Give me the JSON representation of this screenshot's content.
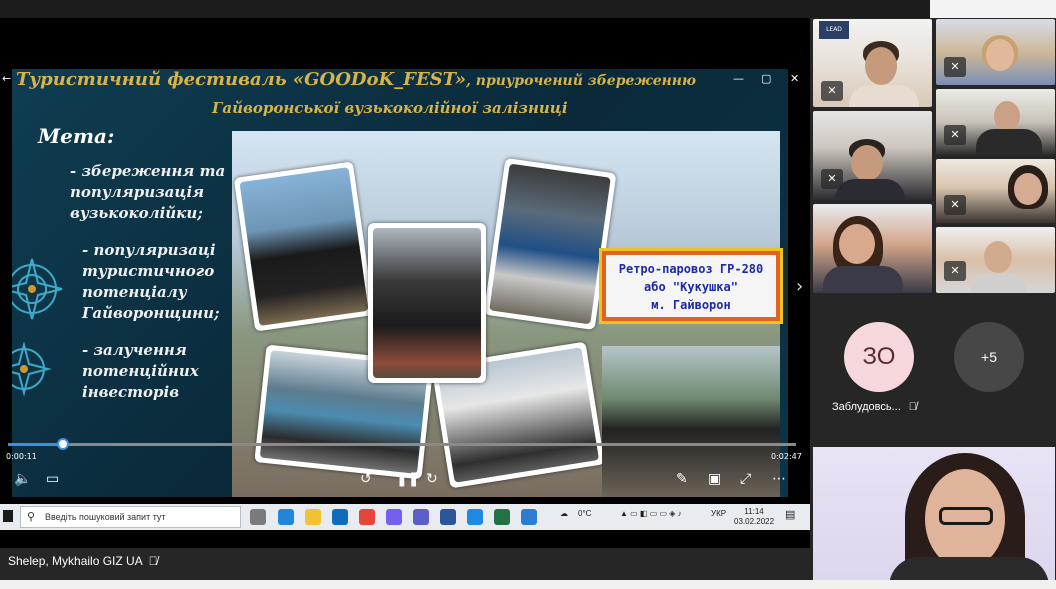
{
  "slide": {
    "title_main": "Туристичний фестиваль «GOODoK_FEST»",
    "title_suffix": ", приурочений збереженню",
    "title_line2": "Гайворонської вузькоколійної залізниці",
    "meta_heading": "Мета:",
    "bullets": [
      "- збереження та популяризація вузькоколійки;",
      "- популяризаці туристичного потенціалу Гайворонщини;",
      "- залучення потенційних інвесторів"
    ],
    "label_line1": "Ретро-паровоз ГР-280",
    "label_line2": "або \"Кукушка\"",
    "label_line3": "м. Гайворон"
  },
  "video": {
    "time_current": "0:00:11",
    "time_total": "0:02:47",
    "progress_fraction": 0.07
  },
  "taskbar": {
    "search_placeholder": "Введіть пошуковий запит тут",
    "weather": "0°C",
    "language": "УКР",
    "time": "11:14",
    "date": "03.02.2022"
  },
  "presenter": {
    "name": "Shelep, Mykhailo GIZ UA"
  },
  "participants": {
    "initials_avatar": "ЗО",
    "initials_name": "Заблудовсь...",
    "more_count": "+5",
    "lead_badge": "LEAD"
  }
}
